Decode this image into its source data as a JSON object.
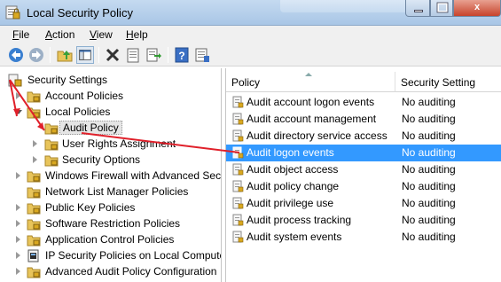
{
  "window": {
    "title": "Local Security Policy",
    "close_glyph": "x",
    "icons": {
      "app": "security-policy-icon",
      "minimize": "minimize-icon",
      "maximize": "maximize-icon",
      "close": "close-icon"
    }
  },
  "menubar": {
    "items": [
      {
        "label": "File",
        "accel": "F",
        "rest": "ile"
      },
      {
        "label": "Action",
        "accel": "A",
        "rest": "ction"
      },
      {
        "label": "View",
        "accel": "V",
        "rest": "iew"
      },
      {
        "label": "Help",
        "accel": "H",
        "rest": "elp"
      }
    ]
  },
  "toolbar": {
    "buttons": [
      "back-icon",
      "forward-icon",
      "up-folder-icon",
      "show-hide-tree-icon",
      "delete-icon",
      "properties-icon",
      "export-list-icon",
      "help-icon",
      "help-topic-icon"
    ]
  },
  "tree": {
    "items": [
      {
        "label": "Security Settings",
        "level": 0,
        "expanded": true,
        "icon": "security-settings-icon"
      },
      {
        "label": "Account Policies",
        "level": 1,
        "expanded": false,
        "icon": "folder-icon"
      },
      {
        "label": "Local Policies",
        "level": 1,
        "expanded": true,
        "icon": "folder-icon"
      },
      {
        "label": "Audit Policy",
        "level": 2,
        "expanded": false,
        "icon": "folder-icon",
        "selected": true
      },
      {
        "label": "User Rights Assignment",
        "level": 2,
        "expanded": false,
        "icon": "folder-icon"
      },
      {
        "label": "Security Options",
        "level": 2,
        "expanded": false,
        "icon": "folder-icon"
      },
      {
        "label": "Windows Firewall with Advanced Secu",
        "level": 1,
        "expanded": false,
        "icon": "folder-icon"
      },
      {
        "label": "Network List Manager Policies",
        "level": 1,
        "expanded": false,
        "icon": "folder-icon"
      },
      {
        "label": "Public Key Policies",
        "level": 1,
        "expanded": false,
        "icon": "folder-icon"
      },
      {
        "label": "Software Restriction Policies",
        "level": 1,
        "expanded": false,
        "icon": "folder-icon"
      },
      {
        "label": "Application Control Policies",
        "level": 1,
        "expanded": false,
        "icon": "folder-icon"
      },
      {
        "label": "IP Security Policies on Local Compute",
        "level": 1,
        "expanded": false,
        "icon": "ip-security-icon"
      },
      {
        "label": "Advanced Audit Policy Configuration",
        "level": 1,
        "expanded": false,
        "icon": "folder-icon"
      }
    ]
  },
  "list": {
    "columns": {
      "policy": "Policy",
      "setting": "Security Setting"
    },
    "rows": [
      {
        "policy": "Audit account logon events",
        "setting": "No auditing"
      },
      {
        "policy": "Audit account management",
        "setting": "No auditing"
      },
      {
        "policy": "Audit directory service access",
        "setting": "No auditing"
      },
      {
        "policy": "Audit logon events",
        "setting": "No auditing",
        "selected": true
      },
      {
        "policy": "Audit object access",
        "setting": "No auditing"
      },
      {
        "policy": "Audit policy change",
        "setting": "No auditing"
      },
      {
        "policy": "Audit privilege use",
        "setting": "No auditing"
      },
      {
        "policy": "Audit process tracking",
        "setting": "No auditing"
      },
      {
        "policy": "Audit system events",
        "setting": "No auditing"
      }
    ],
    "row_icon": "policy-item-icon"
  },
  "colors": {
    "selection": "#3399ff",
    "annotation_arrow": "#e0202a"
  }
}
